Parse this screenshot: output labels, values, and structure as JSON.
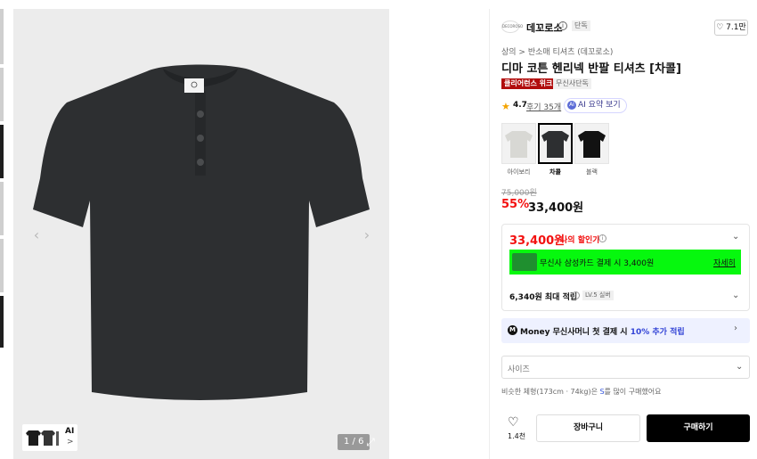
{
  "gallery": {
    "counter": "1 / 6",
    "ai_chip_label": "AI",
    "ai_chip_arrow": ">",
    "left_arrow": "‹",
    "right_arrow": "›",
    "expand_icon": "⤢"
  },
  "brand": {
    "logo_text": "DECOROSO",
    "name": "데꼬로소",
    "info": "i",
    "badge": "단독",
    "likes": "7.1만"
  },
  "product": {
    "breadcrumb": "상의 > 반소매 티셔츠 (데꼬로소)",
    "title": "디마 코튼 헨리넥 반팔 티셔츠 [차콜]",
    "tag_clearance": "클리어런스 위크",
    "tag_exclusive": "무신사단독",
    "rating_star": "★",
    "rating": "4.7",
    "reviews": "후기 35개",
    "ai_summary_icon": "AI",
    "ai_summary": "AI 요약 보기"
  },
  "colors": [
    {
      "label": "아이보리",
      "selected": false,
      "color": "#d8d8d4"
    },
    {
      "label": "차콜",
      "selected": true,
      "color": "#2d2f31"
    },
    {
      "label": "블랙",
      "selected": false,
      "color": "#121212"
    }
  ],
  "pricing": {
    "original": "75,000원",
    "discount": "55%",
    "price": "33,400원",
    "my_price": "33,400원",
    "my_price_label": "나의 할인가",
    "my_price_info": "i",
    "card_offer_text": "무신사 삼성카드 결제 시 3,400원",
    "card_offer_more": "자세히",
    "points": "6,340원 최대 적립",
    "points_info": "i",
    "level_badge": "LV.5 실버"
  },
  "money": {
    "icon": "M",
    "prefix": "Money 무신사머니 첫 결제 시 ",
    "highlight": "10% 추가 적립"
  },
  "size": {
    "placeholder": "사이즈",
    "hint_prefix": "비슷한 체형(173cm · 74kg)은 ",
    "hint_size": "S",
    "hint_suffix": "를 많이 구매했어요"
  },
  "actions": {
    "wish_icon": "♡",
    "wish_count": "1.4천",
    "cart": "장바구니",
    "buy": "구매하기"
  },
  "chevron": "⌄",
  "chevron_right": "›",
  "heart": "♡"
}
